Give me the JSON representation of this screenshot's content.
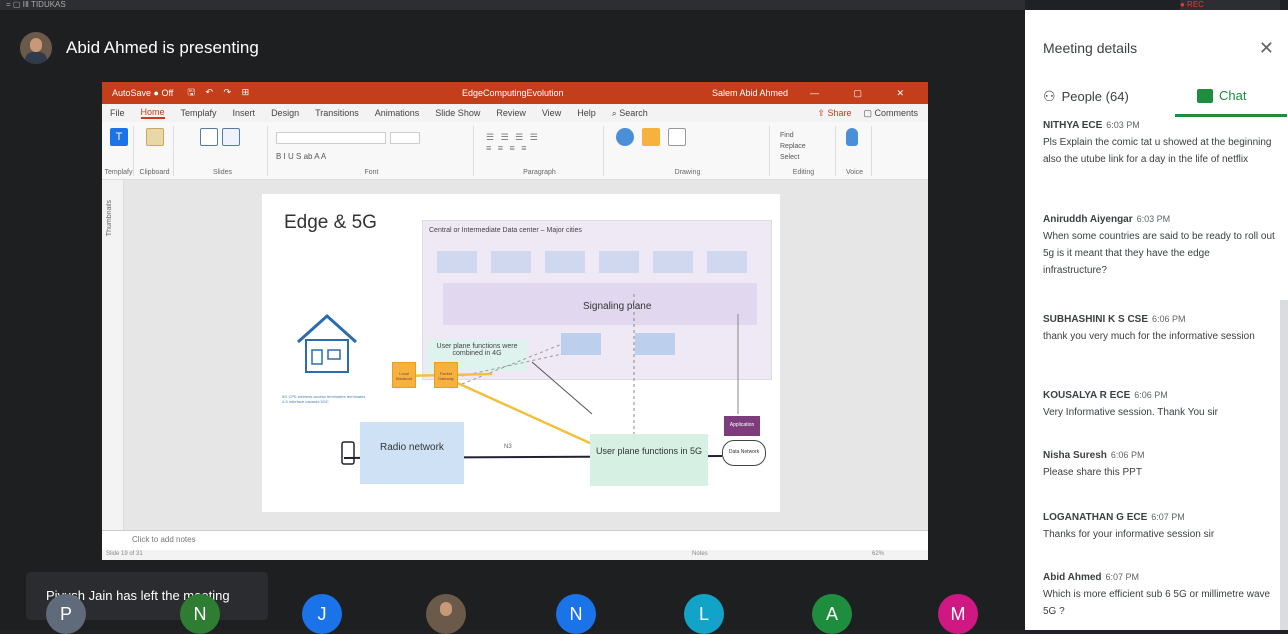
{
  "topstrip": {
    "left_text": "= ▢ ⅠⅡ  TIDUKAS",
    "right_text": "● REC"
  },
  "presenter": {
    "label": "Abid Ahmed is presenting"
  },
  "ppt": {
    "autosave": "AutoSave ● Off",
    "quick_access": "🖫 ↶ ↷ ⊞",
    "filename": "EdgeComputingEvolution",
    "user": "Salem Abid Ahmed",
    "menu": [
      "File",
      "Home",
      "Templafy",
      "Insert",
      "Design",
      "Transitions",
      "Animations",
      "Slide Show",
      "Review",
      "View",
      "Help",
      "Search"
    ],
    "share": "Share",
    "comments": "Comments",
    "ribbon_groups": [
      "Templafy",
      "Clipboard",
      "Slides",
      "Font",
      "Paragraph",
      "Drawing",
      "Editing",
      "Voice"
    ],
    "ribbon_labels": {
      "templafy": "Templafy",
      "paste": "Paste",
      "new_slide": "New Slide",
      "reuse": "Reuse Slides",
      "layout": "Layout",
      "reset": "Reset",
      "section": "Section",
      "shapes": "Shapes",
      "arrange": "Arrange",
      "find": "Find",
      "replace": "Replace",
      "select": "Select",
      "dictate": "Dictate"
    },
    "thumbnails_label": "Thumbnails",
    "notes_placeholder": "Click to add notes",
    "status_left": "Slide 19 of 31",
    "status_notes": "Notes",
    "status_zoom": "62%"
  },
  "slide": {
    "title": "Edge & 5G",
    "dc_label": "Central or Intermediate Data center – Major cities",
    "signaling": "Signaling plane",
    "up4g": "User plane functions were combined in 4G",
    "radio": "Radio network",
    "up5g": "User plane functions in 5G",
    "app": "Application",
    "data_network": "Data Network",
    "cpe_label": "5G CPE",
    "cpe_note": "5G CPE wireless access terminates terminates 4-5 interface towards 5GC",
    "n3": "N3",
    "orange1": "Local Breakout",
    "orange2": "Packet Gateway"
  },
  "panel": {
    "title": "Meeting details",
    "people_tab": "People (64)",
    "chat_tab": "Chat",
    "messages": [
      {
        "sender": "NITHYA ECE",
        "time": "6:03 PM",
        "text": "Pls Explain the comic tat u showed at the beginning also the utube link for a day in the life of netflix"
      },
      {
        "sender": "Aniruddh Aiyengar",
        "time": "6:03 PM",
        "text": "When some countries are said to be ready to roll out 5g is it meant that they have the edge infrastructure?"
      },
      {
        "sender": "SUBHASHINI K S CSE",
        "time": "6:06 PM",
        "text": "thank you very much for the informative session"
      },
      {
        "sender": "KOUSALYA R ECE",
        "time": "6:06 PM",
        "text": "Very Informative session. Thank You sir"
      },
      {
        "sender": "Nisha Suresh",
        "time": "6:06 PM",
        "text": "Please share this PPT"
      },
      {
        "sender": "LOGANATHAN G ECE",
        "time": "6:07 PM",
        "text": "Thanks for your informative session sir"
      },
      {
        "sender": "Abid Ahmed",
        "time": "6:07 PM",
        "text": "Which is more efficient sub 6 5G or millimetre wave 5G ?"
      }
    ]
  },
  "toast": {
    "text": "Piyush Jain has left the meeting"
  },
  "participants": [
    {
      "initial": "P",
      "color": "#5f6b7a"
    },
    {
      "initial": "N",
      "color": "#2e7d32"
    },
    {
      "initial": "J",
      "color": "#1a73e8"
    },
    {
      "initial": "",
      "color": "#6b5a4a"
    },
    {
      "initial": "N",
      "color": "#1a73e8"
    },
    {
      "initial": "L",
      "color": "#12a4c8"
    },
    {
      "initial": "A",
      "color": "#1e8e3e"
    },
    {
      "initial": "M",
      "color": "#d01884"
    }
  ]
}
